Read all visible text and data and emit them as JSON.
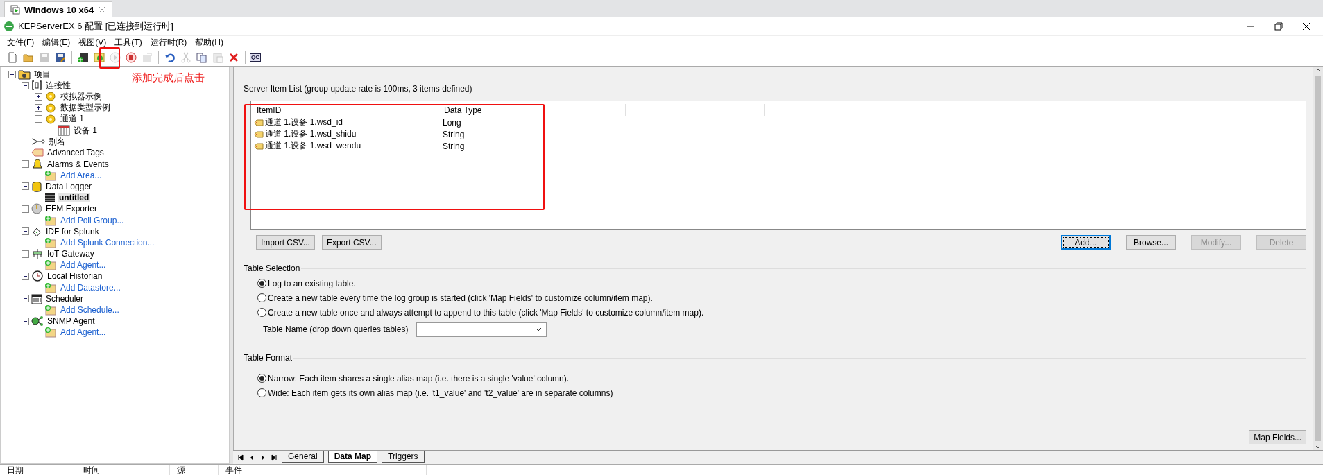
{
  "host_tab": {
    "label": "Windows 10 x64",
    "selected": true
  },
  "window": {
    "title": "KEPServerEX 6 配置 [已连接到运行时]"
  },
  "menu": [
    "文件(F)",
    "编辑(E)",
    "视图(V)",
    "工具(T)",
    "运行时(R)",
    "帮助(H)"
  ],
  "toolbar": [
    {
      "kind": "new",
      "disabled": false
    },
    {
      "kind": "open",
      "disabled": false
    },
    {
      "kind": "save",
      "disabled": true
    },
    {
      "kind": "save-as",
      "disabled": false
    },
    {
      "kind": "separator"
    },
    {
      "kind": "add-channel",
      "disabled": false
    },
    {
      "kind": "apply",
      "disabled": false
    },
    {
      "kind": "play",
      "disabled": true
    },
    {
      "kind": "stop",
      "disabled": false
    },
    {
      "kind": "properties",
      "disabled": true
    },
    {
      "kind": "separator"
    },
    {
      "kind": "undo",
      "disabled": false
    },
    {
      "kind": "cut",
      "disabled": true
    },
    {
      "kind": "copy",
      "disabled": false
    },
    {
      "kind": "paste",
      "disabled": true
    },
    {
      "kind": "delete",
      "disabled": false
    },
    {
      "kind": "separator"
    },
    {
      "kind": "qc",
      "label": "QC",
      "disabled": false
    }
  ],
  "tree": [
    {
      "label": "项目",
      "kind": "project",
      "expanded": true,
      "selected": false,
      "children": [
        {
          "label": "连接性",
          "kind": "connectivity",
          "expanded": true,
          "selected": false,
          "children": [
            {
              "label": "模拟器示例",
              "kind": "channel",
              "expanded": false,
              "selected": false
            },
            {
              "label": "数据类型示例",
              "kind": "channel",
              "expanded": false,
              "selected": false
            },
            {
              "label": "通道 1",
              "kind": "channel",
              "expanded": true,
              "selected": false,
              "children": [
                {
                  "label": "设备 1",
                  "kind": "device",
                  "selected": false
                }
              ]
            }
          ]
        },
        {
          "label": "别名",
          "kind": "alias",
          "selected": false
        },
        {
          "label": "Advanced Tags",
          "kind": "tags",
          "selected": false
        },
        {
          "label": "Alarms & Events",
          "kind": "alarms",
          "expanded": true,
          "selected": false,
          "children": [
            {
              "label": "Add Area...",
              "kind": "action",
              "selected": false
            }
          ]
        },
        {
          "label": "Data Logger",
          "kind": "logger",
          "expanded": true,
          "selected": false,
          "children": [
            {
              "label": "untitled",
              "kind": "log-group",
              "selected": true
            }
          ]
        },
        {
          "label": "EFM Exporter",
          "kind": "efm",
          "expanded": true,
          "selected": false,
          "children": [
            {
              "label": "Add Poll Group...",
              "kind": "action",
              "selected": false
            }
          ]
        },
        {
          "label": "IDF for Splunk",
          "kind": "idf",
          "expanded": true,
          "selected": false,
          "children": [
            {
              "label": "Add Splunk Connection...",
              "kind": "action",
              "selected": false
            }
          ]
        },
        {
          "label": "IoT Gateway",
          "kind": "iot",
          "expanded": true,
          "selected": false,
          "children": [
            {
              "label": "Add Agent...",
              "kind": "action",
              "selected": false
            }
          ]
        },
        {
          "label": "Local Historian",
          "kind": "historian",
          "expanded": true,
          "selected": false,
          "children": [
            {
              "label": "Add Datastore...",
              "kind": "action",
              "selected": false
            }
          ]
        },
        {
          "label": "Scheduler",
          "kind": "scheduler",
          "expanded": true,
          "selected": false,
          "children": [
            {
              "label": "Add Schedule...",
              "kind": "action",
              "selected": false
            }
          ]
        },
        {
          "label": "SNMP Agent",
          "kind": "snmp",
          "expanded": true,
          "selected": false,
          "children": [
            {
              "label": "Add Agent...",
              "kind": "action",
              "selected": false
            }
          ]
        }
      ]
    }
  ],
  "server_item_list": {
    "title": "Server Item List (group update rate is 100ms, 3 items defined)",
    "columns": [
      "ItemID",
      "Data Type"
    ],
    "rows": [
      [
        "通道 1.设备 1.wsd_id",
        "Long"
      ],
      [
        "通道 1.设备 1.wsd_shidu",
        "String"
      ],
      [
        "通道 1.设备 1.wsd_wendu",
        "String"
      ]
    ],
    "left_buttons": [
      {
        "label": "Import CSV...",
        "disabled": false
      },
      {
        "label": "Export CSV...",
        "disabled": false
      }
    ],
    "right_buttons": [
      {
        "label": "Add...",
        "disabled": false,
        "focused": true
      },
      {
        "label": "Browse...",
        "disabled": false,
        "focused": false
      },
      {
        "label": "Modify...",
        "disabled": true,
        "focused": false
      },
      {
        "label": "Delete",
        "disabled": true,
        "focused": false
      }
    ]
  },
  "table_selection": {
    "title": "Table Selection",
    "options": [
      {
        "label": "Log to an existing table.",
        "selected": true
      },
      {
        "label": "Create a new table every time the log group is started (click 'Map Fields' to customize column/item map).",
        "selected": false
      },
      {
        "label": "Create a new table once and always attempt to append to this table (click 'Map Fields' to customize column/item map).",
        "selected": false
      }
    ],
    "table_name_label": "Table Name (drop down queries tables)"
  },
  "table_format": {
    "title": "Table Format",
    "options": [
      {
        "label": "Narrow: Each item shares a single alias map (i.e. there is a single 'value' column).",
        "selected": true
      },
      {
        "label": "Wide: Each item gets its own alias map (i.e. 't1_value' and 't2_value' are in separate columns)",
        "selected": false
      }
    ],
    "map_fields_button": "Map Fields..."
  },
  "page_tabs": [
    {
      "label": "General",
      "selected": false
    },
    {
      "label": "Data Map",
      "selected": true
    },
    {
      "label": "Triggers",
      "selected": false
    }
  ],
  "event_log": {
    "columns": [
      "日期",
      "时间",
      "源",
      "事件"
    ]
  },
  "annotations": [
    {
      "kind": "box"
    },
    {
      "kind": "note",
      "text": "添加完成后点击"
    },
    {
      "kind": "box"
    }
  ]
}
